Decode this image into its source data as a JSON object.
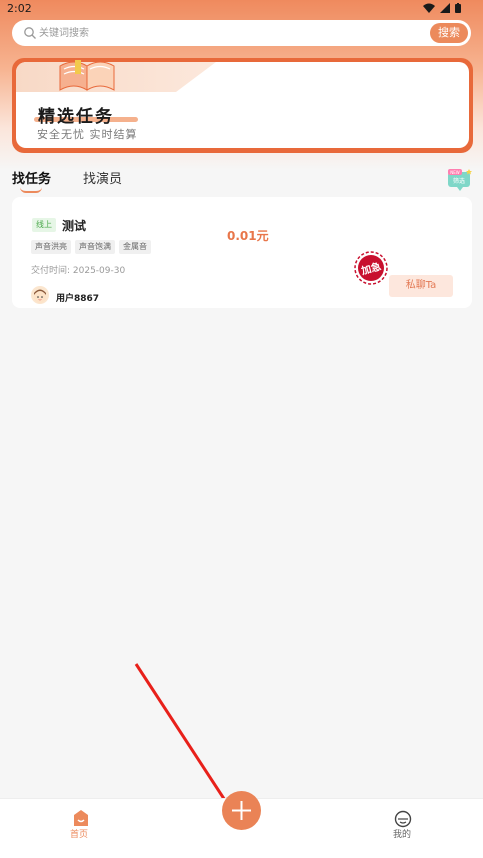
{
  "status_bar": {
    "time": "2:02"
  },
  "search": {
    "placeholder": "关键词搜索",
    "button_label": "搜索"
  },
  "banner": {
    "title": "精选任务",
    "subtitle": "安全无忧 实时结算"
  },
  "tabs": [
    {
      "label": "找任务",
      "active": true
    },
    {
      "label": "找演员",
      "active": false
    }
  ],
  "filter": {
    "badge": "NEW",
    "label": "筛选"
  },
  "task_card": {
    "mode_badge": "线上",
    "title": "测试",
    "price": "0.01元",
    "tags": [
      "声音洪亮",
      "声音饱满",
      "金属音"
    ],
    "deadline": "交付时间: 2025-09-30",
    "user_name": "用户8867",
    "urgent_label": "加急",
    "chat_button": "私聊Ta"
  },
  "bottom_nav": {
    "home_label": "首页",
    "mine_label": "我的"
  },
  "colors": {
    "accent": "#ec8a5c",
    "banner_border": "#e8693a",
    "urgent": "#c8102e",
    "annotation_arrow": "#e8201a"
  }
}
